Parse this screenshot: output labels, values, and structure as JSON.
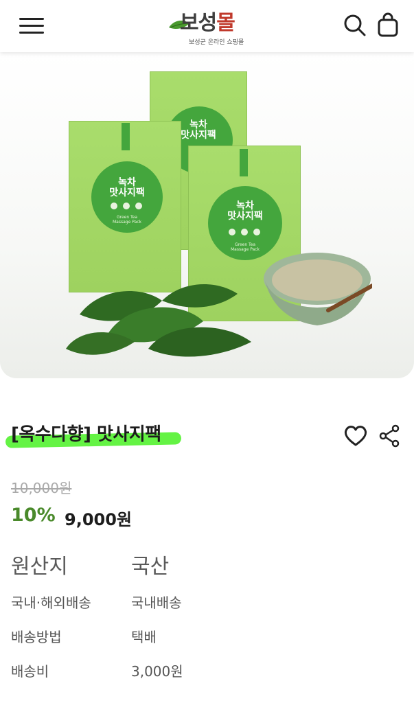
{
  "header": {
    "logo_text_dark": "보성",
    "logo_text_red": "몰",
    "logo_subtitle": "보성군 온라인 쇼핑몰",
    "icons": [
      "menu-icon",
      "search-icon",
      "cart-icon"
    ]
  },
  "product": {
    "box_label_kr": "녹차\n맛사지팩",
    "box_label_en": "Green Tea Massage Pack",
    "box_tag": "옥수다향",
    "title": "[옥수다향] 맛사지팩",
    "original_price": "10,000원",
    "discount": "10%",
    "sale_price": "9,000원",
    "icons": [
      "heart-icon",
      "share-icon"
    ]
  },
  "info": [
    {
      "key": "원산지",
      "value": "국산"
    },
    {
      "key": "국내·해외배송",
      "value": "국내배송"
    },
    {
      "key": "배송방법",
      "value": "택배"
    },
    {
      "key": "배송비",
      "value": "3,000원"
    }
  ],
  "colors": {
    "accent_green": "#4a8a2b",
    "highlight": "#5cf23a",
    "pack_green": "#a9dd6c",
    "logo_red": "#c0392b"
  }
}
